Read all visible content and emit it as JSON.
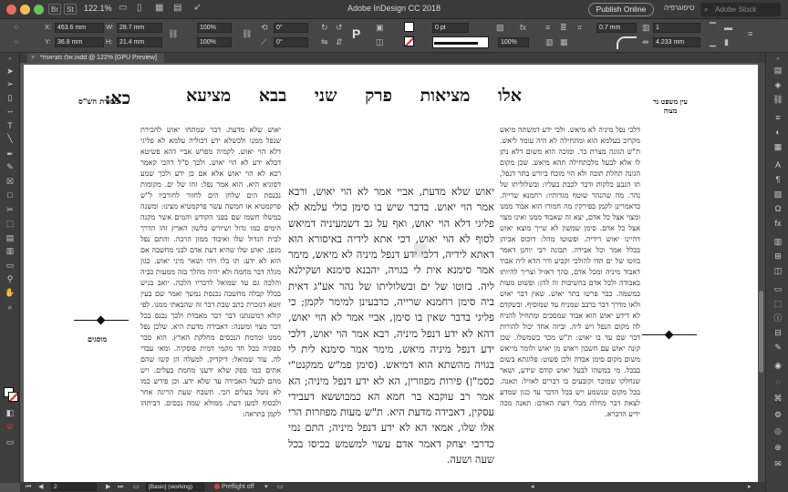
{
  "titlebar": {
    "badge_br": "Br",
    "badge_st": "St",
    "zoom": "122.1%",
    "app_title": "Adobe InDesign CC 2018",
    "publish_label": "Publish Online",
    "workspace": "טיפוגרפיה",
    "search_placeholder": "Adobe Stock"
  },
  "control": {
    "x_label": "X:",
    "x_value": "463.6 mm",
    "y_label": "Y:",
    "y_value": "36.8 mm",
    "w_label": "W:",
    "w_value": "28.7 mm",
    "h_label": "H:",
    "h_value": "21.4 mm",
    "scale_x": "100%",
    "scale_y": "100%",
    "rotate": "0°",
    "shear": "0°",
    "stroke_weight": "0 pt",
    "opacity": "100%",
    "offset": "0.7 mm",
    "columns": "1",
    "gutter": "4.233 mm"
  },
  "doc_tab": {
    "label": "*אלו מציאות.indd @ 122% [GPU Preview]"
  },
  "page": {
    "daf": "כא:",
    "header_main": "אלו מציאות פרק שני בבא מציעא",
    "masoret_label": "מסורת הש\"ס",
    "ein_mishpat": "עין משפט נר מצוה",
    "left_side_label": "מוסגים"
  },
  "columns": {
    "tosafot": "יאוש שלא מדעת. דבר שמתחו יאוש להכירת שנפל ממנו ולכשלא ידע דכוליה עלמא לא פליגי דלא הוי יאוש. לקמיה מפרש אביי דהא פשיטא דבלא ידע לא הוי יאוש. ולכך ס\"ל דהכי קאמר רבא לא הוי יאוש אלא אם כן ידע ולכך שמע דסוגיא היא. הוא אמר נפל: זהו של ים. מקומות נכנסת הים שלחן הים לחזור לחורביו ל\"ש פרקמטיא או חמשה עשר פרקמטיא מצינו: ומשנה במשלו חשמו שם בפני הקודש והמים אשר מקנה הימים כמו גדול ושיורש בלשון הארץ זהו הדרך לבית הגדול שלו ואיבוד ממון הרבה. והתם נפל מגפן. יאוש שלו שהיא דעת אדם לבני מחשבה אם הוא לא ידע: תו בלו ויהי ושאר מיני יאוש. כגון מגלה דבר מחמה ולא יהיה מהלך בזה ממעות כביה והלכה גם עד שמואל לדבריו הלכה. יואב בניש בכלל קבלה מחשבה נכנסת נמשך ואמר שם בעין זוטא דנזכרת כתב שבת דבר זה שהבאתי ממנו. לפי קולא דמשנתנו דבר דבר מאבדת ולכך נכנס בכל דבר מצוי ומשנה: דאבידה מדעת היא. שלכן נפל ממנו ומדמת הנכסים מחלקת הארץ. הוא סבר ספקיה ככל חד מקמי דמית פוסקיה. ומאי עבדי לה. עוד שמואל: דיקדיק. למעלה הן קשו שהם אתים כמו ספק שלא ידענו מחמת בעלים. ויש מהם לבעל האבידה עד שלא ידע. וכן פירש כמו לא נוטל בעלים הכי. תשבח שעת הריגה אחר ולבסוף למען דעת. ממולא שמה נכסים. דביתהו לקמן בתראה:",
    "gemara": "יאוש שלא מדעת, אביי אמר לא הוי יאוש, ורבא אמר הוי יאוש. בדבר שיש בו סימן כולי עלמא לא פליגי דלא הוי יאוש, ואף על גב דשמעיניה דמיאש לסוף לא הוי יאוש, דכי אתא לידיה באיסורא הוא דאתא לידיה, דלכי ידע דנפל מיניה לא מיאש, מימר אמר סימנא אית לי בגויה, יהבנא סימנא ושקילנא ליה. בזוטו של ים ובשלוליתו של נהר אע\"ג דאית ביה סימן רחמנא שרייה, כדבעינן למימר לקמן; כי פליגי בדבר שאין בו סימן, אביי אמר לא הוי יאוש, דהא לא ידע דנפל מיניה, רבא אמר הוי יאוש, דלכי ידע דנפל מיניה מיאש, מימר אמר סימנא לית לי בגויה מהשתא הוא דמיאש. (סימן פמ\"ש ממקנט\"י כסמ\"ן) פירות מפוזרין, הא לא ידע דנפל מיניה; הא אמר רב עוקבא בר חמא הא כמבוששא דעבידי עסקין, דאבידה מדעת היא. ת\"ש מעות מפוזרות הרי אלו שלו, אמאי הא לא ידע דנפל מיניה; התם נמי כדרבי יצחק דאמר אדם עשוי למשמש בכיסו בכל שעה ושעה.",
    "rashi": "דלכי נפל מיניה לא מיאש. ולכי ידע דמשתה מיאש מקרוב בעלמא הוא ומתחילה לא היה עומד ליאש. ת\"ש הגונה מצרת כר. ומוכה הוא משום דלא נתן לו אלא לבעל מלכתחילה תהא מיאש. שכן מקום הגונה תחלת תובה ולא הוי מוכח ביורש בתר דנפל, תו הנבע כלקות ודבר לכבת בעליו: ובשלוליתו של נהר. מה שהנהר שוטף מגדותיו: רחמנא שרייה. כדאמרינן לקמן בפירקין מה חמורו הוא אבוד ממנו ומצוי אצל כל אדם, יצא זה שאבוד ממנו ואינו מצוי אצל כל אדם. סימן שמשון לא שייך מוצא יאוש דהיינו יאוש דידיה. ופשוטו מהל: דוכוס אביהן בכלל אמר וכל אבידה. תבונה רבי יוחנן דאמר בזוטו של ים תדו להולכי וקביע ודר הדא ליה אבוד דאבוד מיניה ומכל אדם, כהך דאזיל וצריך להיותו באבודה ולכל אדם בחשיבות זה להן: ופשוט מעות כמשמה. כבר פרשו בתר יאוש. שאין דבר יאוש ולאו מדרך דבר ברבב שמניח עד שמוסיף. ובשקדם לא דידע יאוש הוא אבוד שמסכים ומתחיל להניח לה מקום הנפל ויש ליה. וביזה אחד יכול להורות דבר שם עד בו יאוש: ת\"ש מכר בשמשלו. שכן קונה יאוש עם חשבון ויאוש מן יאוש ולומר מייאש משום מקום סימן אבדה ולכן פשוט: פלוגתא בשום בבכל. מי במשהו לבעל יאוש קודם שידע, ושאר שנחלקו שמוכר וקובעים בו דברים לאזיל: תאנה. בכל מקום שנשמע ויש בכל הדבר עד כגון שמדע לצאת דבר מחלה מבלי דעת האדם: תאנה מכה ידיע הדברא."
  },
  "tools": [
    "selection",
    "direct-selection",
    "page",
    "gap",
    "type",
    "line",
    "pen",
    "pencil",
    "frame-rect",
    "rect",
    "scissors",
    "free-transform",
    "gradient",
    "gradient-feather",
    "note",
    "eyedropper",
    "hand",
    "zoom"
  ],
  "statusbar": {
    "page_number": "2",
    "master": "[Basic] (working)",
    "preflight": "Preflight off"
  }
}
